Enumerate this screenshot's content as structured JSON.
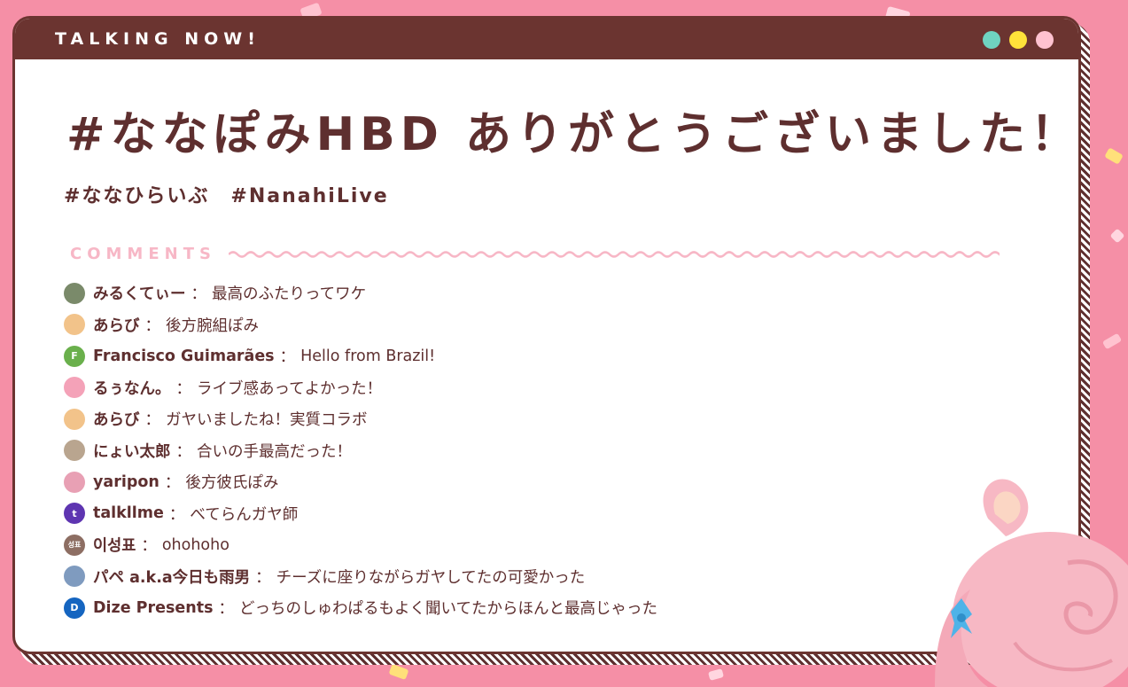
{
  "header": {
    "title": "TALKING NOW!",
    "dots": [
      {
        "name": "mint-dot",
        "color": "#6fd3c0"
      },
      {
        "name": "yellow-dot",
        "color": "#ffe23a"
      },
      {
        "name": "pink-dot",
        "color": "#ffc2d0"
      }
    ]
  },
  "main": {
    "title": "#ななぽみHBD ありがとうございました！",
    "hashtags": "#ななひらいぶ　#NanahiLive"
  },
  "comments": {
    "label": "COMMENTS",
    "items": [
      {
        "author": "みるくてぃー",
        "text": "最高のふたりってワケ",
        "avatar_color": "#7a8a6a",
        "avatar_letter": ""
      },
      {
        "author": "あらび",
        "text": "後方腕組ぽみ",
        "avatar_color": "#f2c38a",
        "avatar_letter": ""
      },
      {
        "author": "Francisco Guimarães",
        "text": "Hello from Brazil!",
        "avatar_color": "#6ab04c",
        "avatar_letter": "F"
      },
      {
        "author": "るぅなん。",
        "text": "ライブ感あってよかった！",
        "avatar_color": "#f4a2b8",
        "avatar_letter": ""
      },
      {
        "author": "あらび",
        "text": "ガヤいましたね！実質コラボ",
        "avatar_color": "#f2c38a",
        "avatar_letter": ""
      },
      {
        "author": "にょい太郎",
        "text": "合いの手最高だった！",
        "avatar_color": "#b9a58f",
        "avatar_letter": ""
      },
      {
        "author": "yaripon",
        "text": "後方彼氏ぽみ",
        "avatar_color": "#e8a0b4",
        "avatar_letter": ""
      },
      {
        "author": "talkllme",
        "text": "べてらんガヤ師",
        "avatar_color": "#5e35b1",
        "avatar_letter": "t"
      },
      {
        "author": "이성표",
        "text": "ohohoho",
        "avatar_color": "#8d6e63",
        "avatar_letter": "성표"
      },
      {
        "author": "パペ a.k.a今日も雨男",
        "text": "チーズに座りながらガヤしてたの可愛かった",
        "avatar_color": "#7f9bbf",
        "avatar_letter": ""
      },
      {
        "author": "Dize Presents",
        "text": "どっちのしゅわぱるもよく聞いてたからほんと最高じゃった",
        "avatar_color": "#1565c0",
        "avatar_letter": "D"
      }
    ]
  },
  "theme": {
    "background": "#f58fa6",
    "frame": "#6b3430",
    "text": "#5e2f2f",
    "comments_label": "#f7b7c6"
  }
}
